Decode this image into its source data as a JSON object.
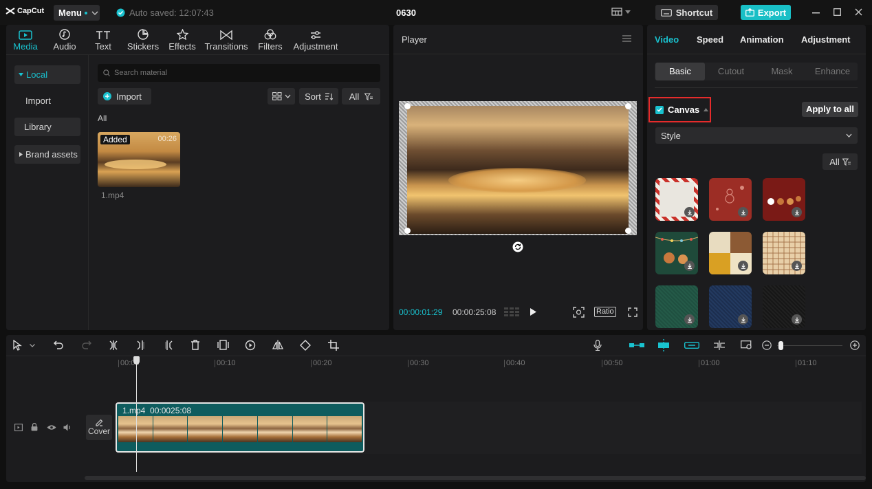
{
  "titlebar": {
    "logo": "CapCut",
    "menu_label": "Menu",
    "autosave": "Auto saved: 12:07:43",
    "project_title": "0630",
    "shortcut_label": "Shortcut",
    "export_label": "Export"
  },
  "media_tabs": [
    {
      "label": "Media",
      "icon": "media-icon",
      "active": true
    },
    {
      "label": "Audio",
      "icon": "audio-icon"
    },
    {
      "label": "Text",
      "icon": "text-icon"
    },
    {
      "label": "Stickers",
      "icon": "stickers-icon"
    },
    {
      "label": "Effects",
      "icon": "effects-icon"
    },
    {
      "label": "Transitions",
      "icon": "transitions-icon"
    },
    {
      "label": "Filters",
      "icon": "filters-icon"
    },
    {
      "label": "Adjustment",
      "icon": "adjustment-icon"
    }
  ],
  "media_sidebar": {
    "local": "Local",
    "import": "Import",
    "library": "Library",
    "brand_assets": "Brand assets"
  },
  "media": {
    "search_placeholder": "Search material",
    "import_label": "Import",
    "sort_label": "Sort",
    "all_filter": "All",
    "section_title": "All",
    "items": [
      {
        "name": "1.mp4",
        "badge": "Added",
        "duration": "00:26"
      }
    ]
  },
  "player": {
    "title": "Player",
    "current_time": "00:00:01:29",
    "total_time": "00:00:25:08",
    "ratio_label": "Ratio"
  },
  "props": {
    "tabs": [
      "Video",
      "Speed",
      "Animation",
      "Adjustment"
    ],
    "active_tab": "Video",
    "subtabs": [
      "Basic",
      "Cutout",
      "Mask",
      "Enhance"
    ],
    "active_subtab": "Basic",
    "canvas_label": "Canvas",
    "apply_all": "Apply to all",
    "style_select": "Style",
    "filter_all": "All",
    "swatches": [
      {
        "name": "candy-stripe-frame"
      },
      {
        "name": "red-snowman-pattern"
      },
      {
        "name": "red-gingerbread-pattern"
      },
      {
        "name": "green-gingerbread-lights"
      },
      {
        "name": "beige-mustard-blocks"
      },
      {
        "name": "beige-plaid"
      },
      {
        "name": "green-texture"
      },
      {
        "name": "navy-texture"
      },
      {
        "name": "dark-texture"
      }
    ]
  },
  "timeline": {
    "ruler": [
      "00:00",
      "00:10",
      "00:20",
      "00:30",
      "00:40",
      "00:50",
      "01:00",
      "01:10"
    ],
    "clip_name": "1.mp4",
    "clip_duration": "00:0025:08",
    "cover_label": "Cover"
  },
  "colors": {
    "accent": "#19c2cf",
    "highlight_box": "#e52b2b",
    "clip": "#0e5c5e"
  }
}
